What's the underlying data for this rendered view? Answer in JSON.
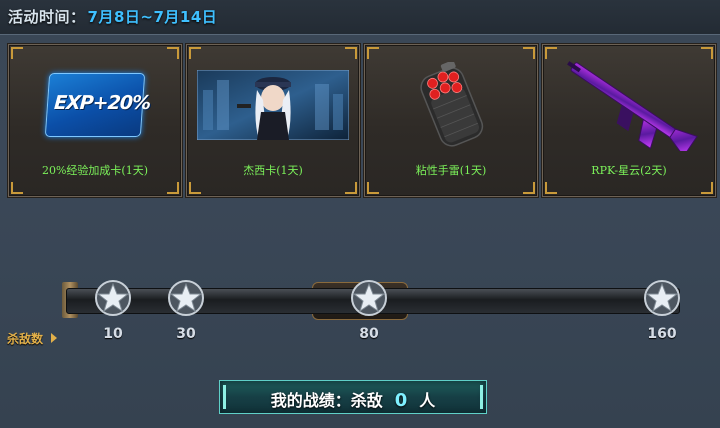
{
  "header": {
    "label": "活动时间：",
    "dates": "7月8日~7月14日"
  },
  "rewards": [
    {
      "name": "20%经验加成卡(1天)",
      "icon": "exp-card-icon",
      "card_text": "EXP+20%"
    },
    {
      "name": "杰西卡(1天)",
      "icon": "character-portrait"
    },
    {
      "name": "粘性手雷(1天)",
      "icon": "sticky-grenade-icon"
    },
    {
      "name": "RPK-星云(2天)",
      "icon": "rifle-icon"
    }
  ],
  "progress": {
    "label": "杀敌数",
    "current": 0,
    "milestones": [
      "10",
      "30",
      "80",
      "160"
    ]
  },
  "record": {
    "prefix": "我的战绩：杀敌",
    "count": "0",
    "unit": "人"
  },
  "colors": {
    "accent": "#3fc0ff",
    "reward_name": "#7cf25a",
    "kills_label": "#e2b04a",
    "record_border": "#5fd0c8"
  }
}
